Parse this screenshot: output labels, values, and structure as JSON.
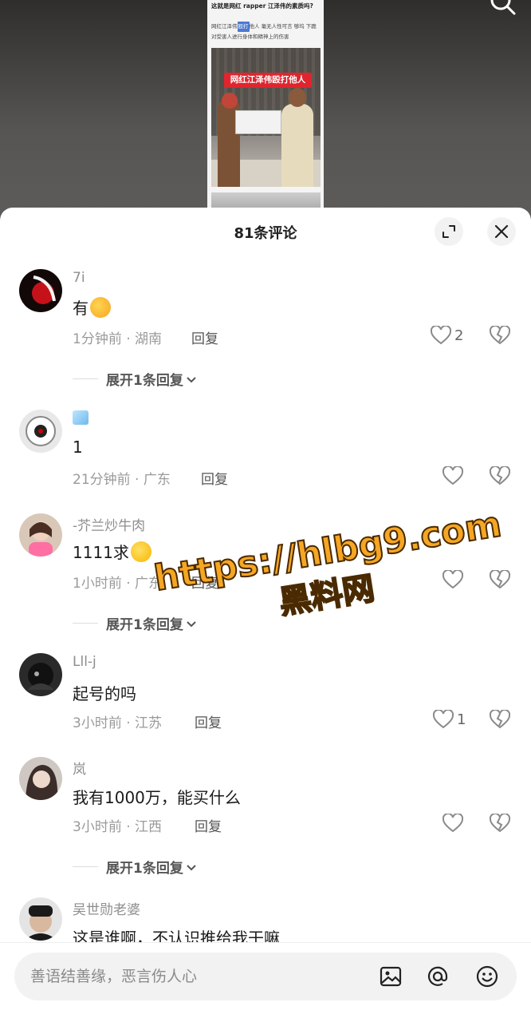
{
  "article": {
    "title": "这就是网红 rapper 江泽伟的素质吗?",
    "text_part1": "网红江泽伟",
    "text_highlight": "殴打",
    "text_part2": "他人 毫无人性可言 够坞 下跪 对受害人进行身体和精神上的伤害",
    "banner": "网红江泽伟殴打他人"
  },
  "sheet": {
    "title": "81条评论"
  },
  "comments": [
    {
      "name": "7i",
      "text": "有",
      "meta": "1分钟前 · 湖南",
      "reply": "回复",
      "likes": "2",
      "expand": "展开1条回复"
    },
    {
      "name": "",
      "text": "1",
      "meta": "21分钟前 · 广东",
      "reply": "回复"
    },
    {
      "name": "-芥兰炒牛肉",
      "text": "1111求",
      "meta": "1小时前 · 广东",
      "reply": "回复",
      "expand": "展开1条回复"
    },
    {
      "name": "Lll-j",
      "text": "起号的吗",
      "meta": "3小时前 · 江苏",
      "reply": "回复",
      "likes": "1"
    },
    {
      "name": "岚",
      "text": "我有1000万，能买什么",
      "meta": "3小时前 · 江西",
      "reply": "回复",
      "expand": "展开1条回复"
    },
    {
      "name": "吴世勋老婆",
      "text": "这是谁啊，不认识推给我干嘛"
    }
  ],
  "input": {
    "placeholder": "善语结善缘，恶言伤人心"
  },
  "watermark": {
    "line1": "https://hlbg9.com",
    "line2": "黑料网"
  },
  "colors": {
    "like_icon": "#8a8a8a",
    "watermark": "#f5a623"
  }
}
